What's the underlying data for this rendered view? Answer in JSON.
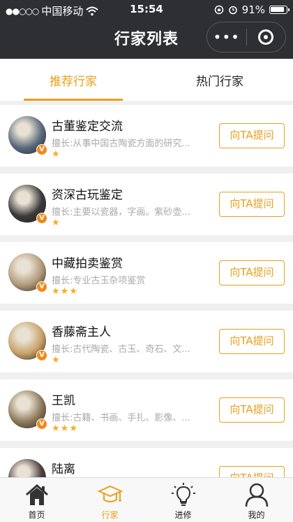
{
  "status": {
    "carrier": "中国移动",
    "signal": "●●○○○",
    "time": "15:54",
    "battery": "91%"
  },
  "nav": {
    "title": "行家列表",
    "more": "•••"
  },
  "tabs": [
    {
      "label": "推荐行家",
      "active": true
    },
    {
      "label": "热门行家",
      "active": false
    }
  ],
  "experts": [
    {
      "name": "古董鉴定交流",
      "specialty": "擅长:从事中国古陶瓷方面的研究...",
      "stars": 1,
      "button": "向TA提问",
      "avatar_color": "#5b6b7d"
    },
    {
      "name": "资深古玩鉴定",
      "specialty": "擅长:主要以瓷器，字画。紫砂壶...",
      "stars": 1,
      "button": "向TA提问",
      "avatar_color": "#3a3a3a"
    },
    {
      "name": "中藏拍卖鉴赏",
      "specialty": "擅长:专业古玉杂项鉴赏",
      "stars": 3,
      "button": "向TA提问",
      "avatar_color": "#b49b7c"
    },
    {
      "name": "香藤斋主人",
      "specialty": "擅长:古代陶瓷、古玉、奇石、文...",
      "stars": 1,
      "button": "向TA提问",
      "avatar_color": "#caa36a"
    },
    {
      "name": "王凯",
      "specialty": "擅长:古籍、书画、手扎、影像、...",
      "stars": 3,
      "button": "向TA提问",
      "avatar_color": "#8e7a5c"
    },
    {
      "name": "陆离",
      "specialty": "",
      "stars": 0,
      "button": "向TA提问",
      "avatar_color": "#4a3e3a"
    }
  ],
  "bottom_tabs": [
    {
      "label": "首页",
      "icon": "home-icon",
      "active": false
    },
    {
      "label": "行家",
      "icon": "graduation-cap-icon",
      "active": true
    },
    {
      "label": "进修",
      "icon": "lightbulb-icon",
      "active": false
    },
    {
      "label": "我的",
      "icon": "user-icon",
      "active": false
    }
  ],
  "colors": {
    "accent": "#e9a01b",
    "topbar": "#2d2f33",
    "badge": "#f08a1c"
  }
}
